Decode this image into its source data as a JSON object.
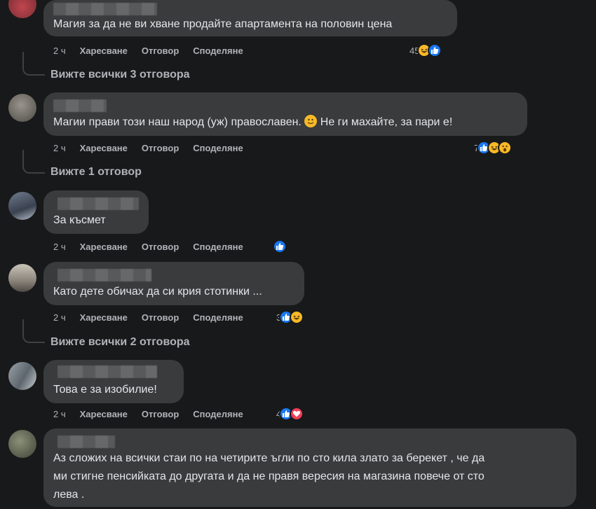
{
  "comments": [
    {
      "text": "Магия за да не ви хване продайте апартамента на половин цена",
      "time": "2 ч",
      "like": "Харесване",
      "reply": "Отговор",
      "share": "Споделяне",
      "reaction_count": "45",
      "reactions": [
        "haha-icon",
        "like-icon"
      ],
      "replies_label": "Вижте всички 3 отговора"
    },
    {
      "text_before": "Магии прави този наш народ (уж) православен.",
      "text_after": "Не ги махайте, за пари е!",
      "time": "2 ч",
      "like": "Харесване",
      "reply": "Отговор",
      "share": "Споделяне",
      "reaction_count": "7",
      "reactions": [
        "like-icon",
        "haha-icon",
        "wow-icon"
      ],
      "replies_label": "Вижте 1 отговор"
    },
    {
      "text": "За късмет",
      "time": "2 ч",
      "like": "Харесване",
      "reply": "Отговор",
      "share": "Споделяне",
      "reaction_count": "",
      "reactions": [
        "like-icon"
      ]
    },
    {
      "text": "Като дете обичах да си крия стотинки ...",
      "time": "2 ч",
      "like": "Харесване",
      "reply": "Отговор",
      "share": "Споделяне",
      "reaction_count": "3",
      "reactions": [
        "like-icon",
        "haha-icon"
      ],
      "replies_label": "Вижте всички 2 отговора"
    },
    {
      "text": "Това е за изобилие!",
      "time": "2 ч",
      "like": "Харесване",
      "reply": "Отговор",
      "share": "Споделяне",
      "reaction_count": "4",
      "reactions": [
        "like-icon",
        "love-icon"
      ]
    },
    {
      "lines": [
        "Аз сложих на всички стаи по на четирите ъгли по сто кила злато за берекет , че да",
        "ми стигне пенсийката до другата и да не правя вересия на магазина повече от сто",
        "лева ."
      ]
    }
  ],
  "colors": {
    "background": "#18191a",
    "bubble": "#3a3b3c",
    "like": "#1877f2",
    "haha": "#f7b928",
    "love": "#f33e58"
  }
}
